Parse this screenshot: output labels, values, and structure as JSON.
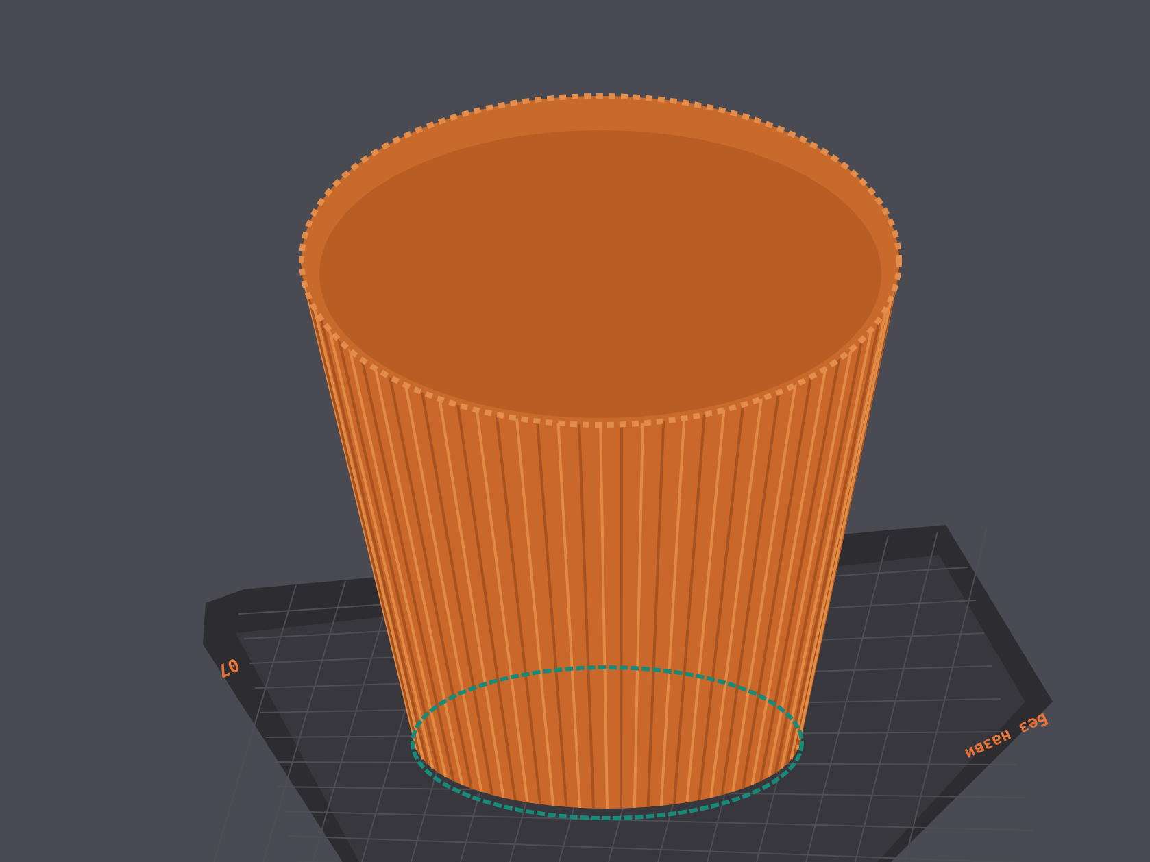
{
  "viewport": {
    "plate": {
      "bed_label": "07",
      "plate_name": "Без назви"
    }
  }
}
